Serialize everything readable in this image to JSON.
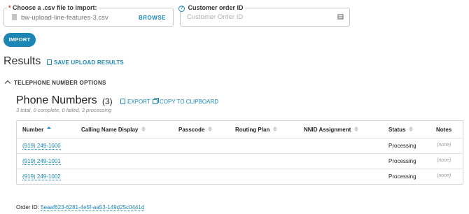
{
  "upload": {
    "required_mark": "*",
    "legend": "Choose a .csv file to import:",
    "file_name": "bw-upload-line-features-3.csv",
    "browse_label": "BROWSE",
    "file_icon": "file-icon"
  },
  "order": {
    "help_mark": "?",
    "legend": "Customer order ID",
    "placeholder": "Customer Order ID",
    "value": "",
    "icon": "id-card-icon"
  },
  "import_label": "IMPORT",
  "results": {
    "title": "Results",
    "save_label": "SAVE UPLOAD RESULTS"
  },
  "options_toggle": "TELEPHONE NUMBER OPTIONS",
  "phone_numbers": {
    "title": "Phone Numbers",
    "count": "(3)",
    "export_label": "EXPORT",
    "copy_label": "COPY TO CLIPBOARD",
    "summary": "3 total, 0 complete, 0 failed, 3 processing"
  },
  "table": {
    "columns": [
      "Number",
      "Calling Name Display",
      "Passcode",
      "Routing Plan",
      "NNID Assignment",
      "Status",
      "Notes"
    ],
    "rows": [
      {
        "number": "(919) 249-1000",
        "status": "Processing",
        "notes": "(none)"
      },
      {
        "number": "(919) 249-1001",
        "status": "Processing",
        "notes": "(none)"
      },
      {
        "number": "(919) 249-1002",
        "status": "Processing",
        "notes": "(none)"
      }
    ]
  },
  "footer": {
    "order_id_label": "Order ID:",
    "order_id": "5eaaf623-6281-4e5f-aa53-149d25c0441d"
  },
  "colors": {
    "accent": "#1b86b5",
    "required": "#c0392b"
  }
}
